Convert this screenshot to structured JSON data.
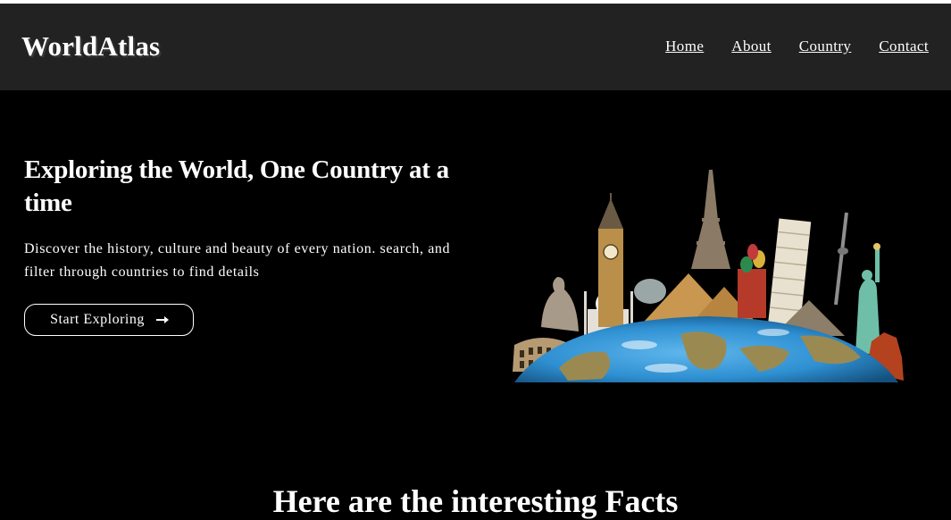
{
  "header": {
    "logo": "WorldAtlas",
    "nav": [
      "Home",
      "About",
      "Country",
      "Contact"
    ]
  },
  "hero": {
    "title": "Exploring the World, One Country at a time",
    "description": "Discover the history, culture and beauty of every nation. search, and filter through countries to find details",
    "cta_label": "Start Exploring",
    "cta_icon": "arrow-right-icon",
    "image_icon": "world-landmarks-globe-image"
  },
  "section": {
    "title": "Here are the interesting Facts"
  },
  "colors": {
    "background": "#000000",
    "header_bg": "#222222",
    "text": "#ffffff",
    "ocean": "#2e8fd1",
    "land": "#9a8a52"
  }
}
